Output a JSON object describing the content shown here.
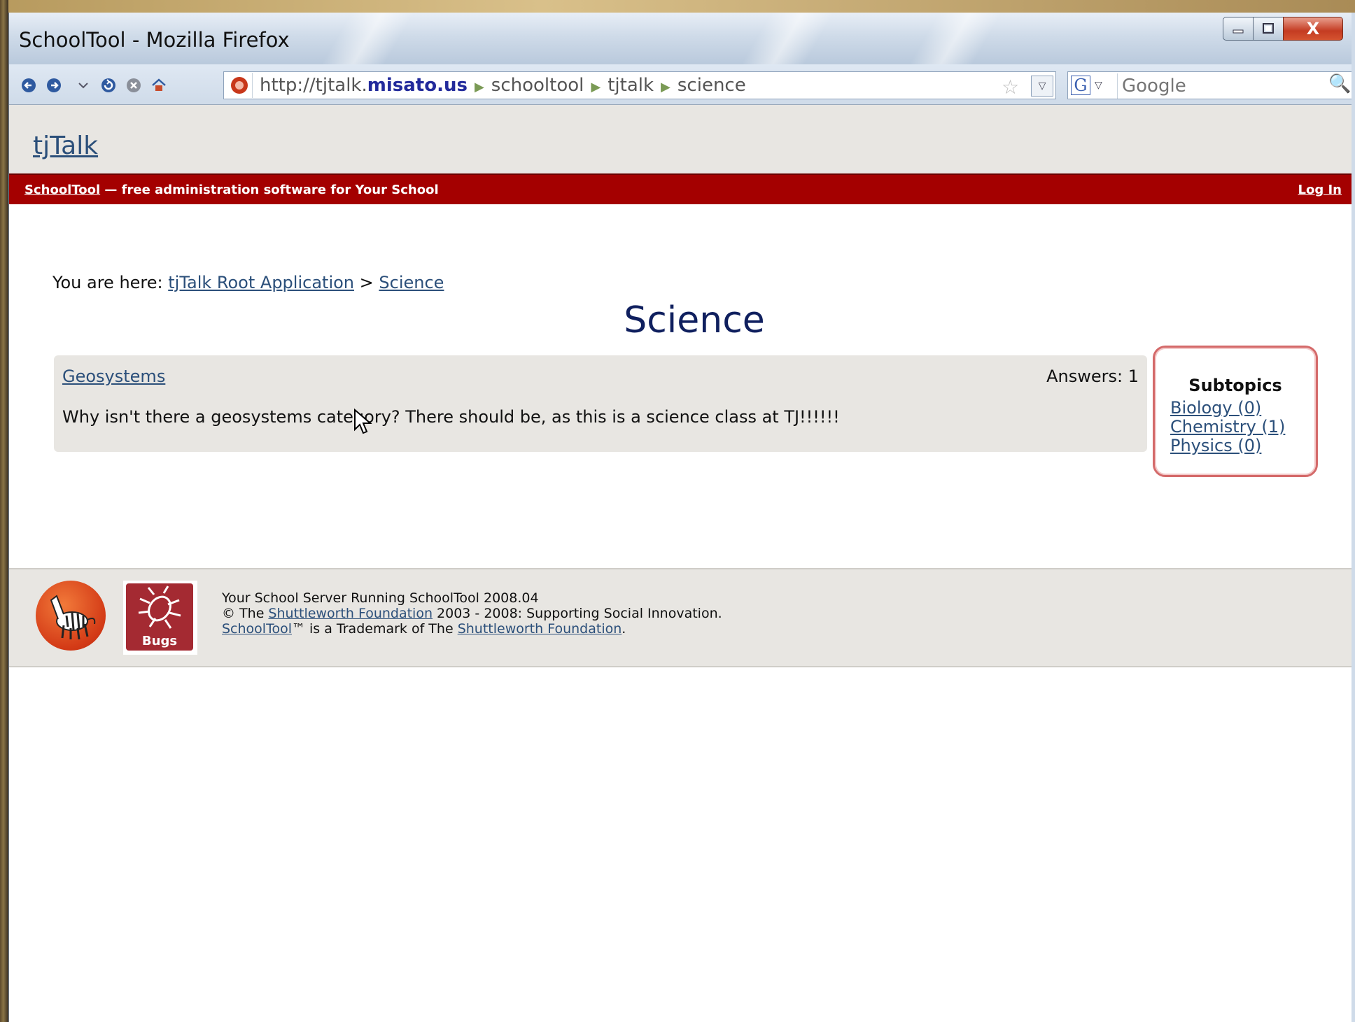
{
  "window": {
    "title": "SchoolTool - Mozilla Firefox",
    "close_glyph": "X"
  },
  "navigation": {
    "url": {
      "prefix": "http://tjtalk.",
      "domain": "misato.us",
      "segments": [
        "schooltool",
        "tjtalk",
        "science"
      ]
    },
    "search": {
      "engine_letter": "G",
      "placeholder": "Google"
    }
  },
  "site": {
    "name": "tjTalk",
    "banner": {
      "product_link": "SchoolTool",
      "tagline": " — free administration software for Your School",
      "login_label": "Log In"
    }
  },
  "breadcrumb": {
    "prefix": "You are here: ",
    "items": [
      "tjTalk Root Application",
      "Science"
    ],
    "separator": " > "
  },
  "page_title": "Science",
  "questions": [
    {
      "title": "Geosystems",
      "answers_label": "Answers: 1",
      "text": "Why isn't there a geosystems category? There should be, as this is a science class at TJ!!!!!!"
    }
  ],
  "subtopics": {
    "title": "Subtopics",
    "items": [
      "Biology (0)",
      "Chemistry (1)",
      "Physics (0)"
    ]
  },
  "footer": {
    "bugs_label": "Bugs",
    "line1": "Your School Server Running SchoolTool 2008.04",
    "line2_prefix": "© The ",
    "line2_link": "Shuttleworth Foundation",
    "line2_suffix": " 2003 - 2008: Supporting Social Innovation.",
    "line3_link": "SchoolTool",
    "line3_middle": "™ is a Trademark of The ",
    "line3_link2": "Shuttleworth Foundation",
    "line3_suffix": "."
  },
  "colors": {
    "banner_red": "#a40000",
    "link_blue": "#2b4f7a",
    "title_navy": "#0f1f5e",
    "panel_gray": "#e8e6e2"
  }
}
